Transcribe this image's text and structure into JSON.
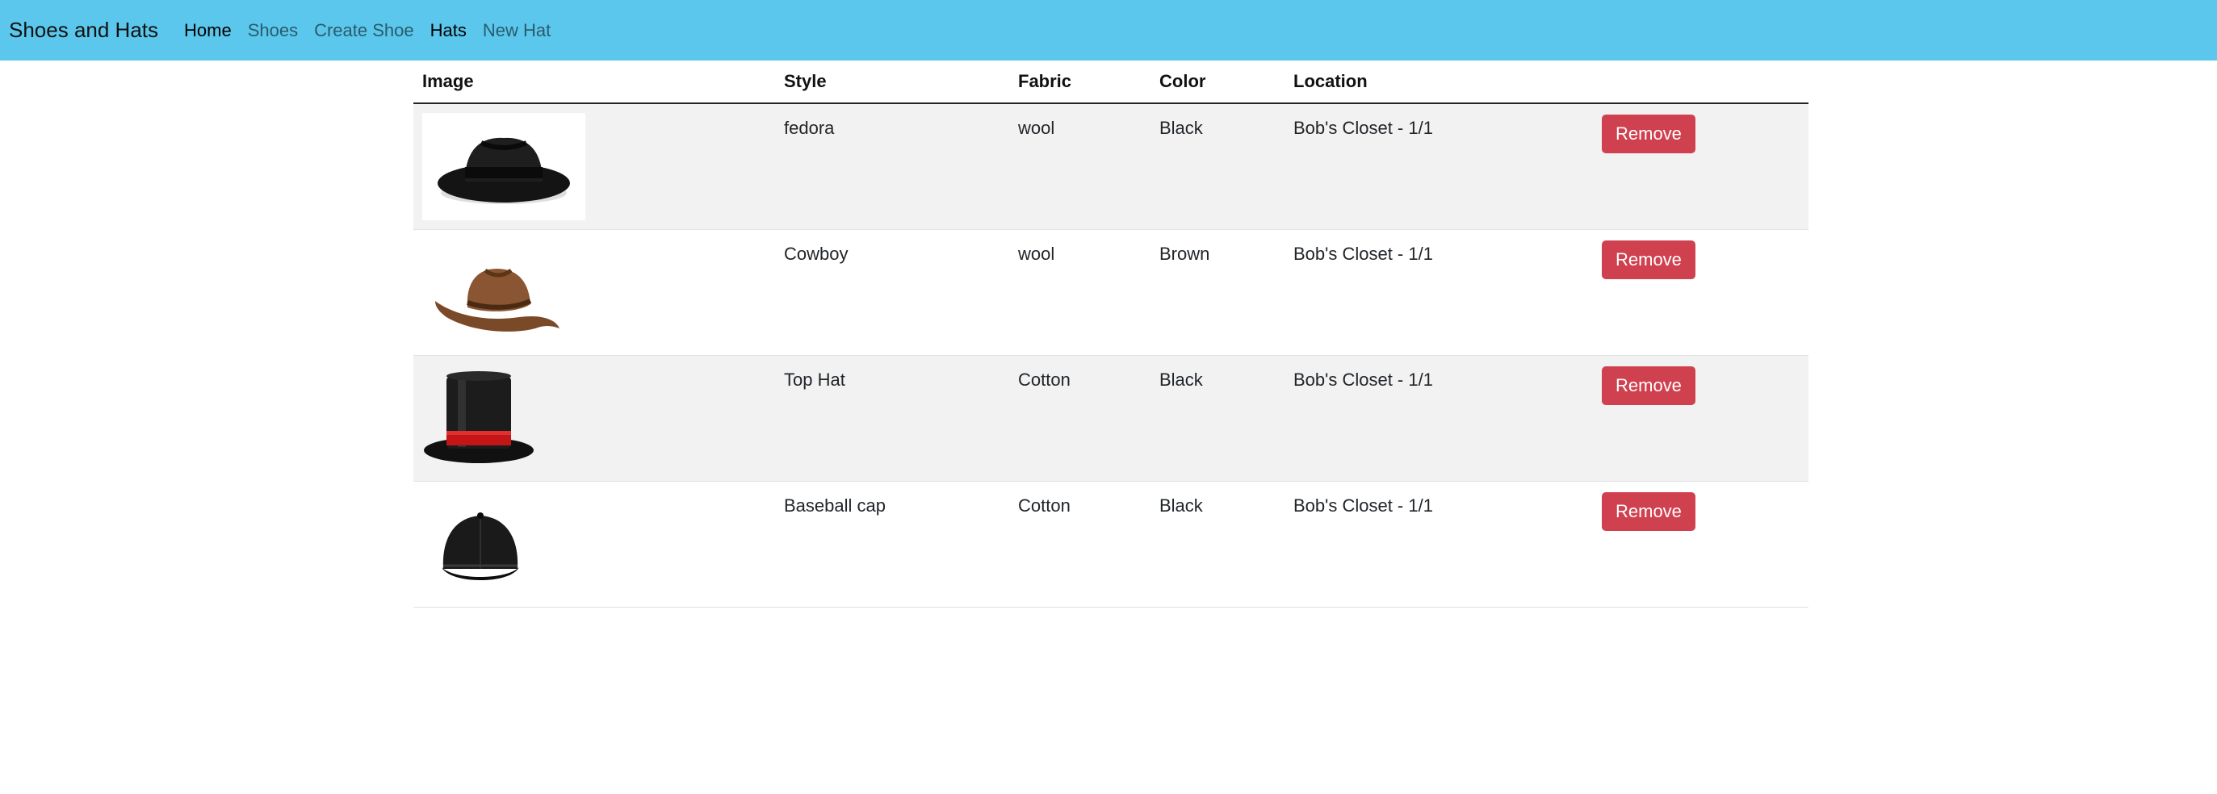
{
  "navbar": {
    "brand": "Shoes and Hats",
    "links": [
      {
        "label": "Home",
        "active": true
      },
      {
        "label": "Shoes",
        "active": false
      },
      {
        "label": "Create Shoe",
        "active": false
      },
      {
        "label": "Hats",
        "active": true
      },
      {
        "label": "New Hat",
        "active": false
      }
    ],
    "background_color": "#5bc7ec"
  },
  "table": {
    "headers": [
      "Image",
      "Style",
      "Fabric",
      "Color",
      "Location",
      ""
    ],
    "rows": [
      {
        "image": "fedora-hat-image",
        "style": "fedora",
        "fabric": "wool",
        "color": "Black",
        "location": "Bob's Closet - 1/1",
        "action": "Remove"
      },
      {
        "image": "cowboy-hat-image",
        "style": "Cowboy",
        "fabric": "wool",
        "color": "Brown",
        "location": "Bob's Closet - 1/1",
        "action": "Remove"
      },
      {
        "image": "top-hat-image",
        "style": "Top Hat",
        "fabric": "Cotton",
        "color": "Black",
        "location": "Bob's Closet - 1/1",
        "action": "Remove"
      },
      {
        "image": "baseball-cap-image",
        "style": "Baseball cap",
        "fabric": "Cotton",
        "color": "Black",
        "location": "Bob's Closet - 1/1",
        "action": "Remove"
      }
    ],
    "button_color": "#d0414f"
  }
}
